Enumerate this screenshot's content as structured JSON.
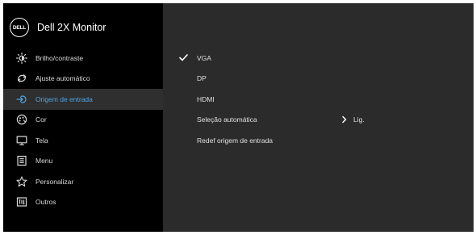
{
  "header": {
    "logo_text": "DELL",
    "title": "Dell 2X Monitor"
  },
  "menu": {
    "items": [
      {
        "label": "Brilho/contraste",
        "icon": "brightness-icon"
      },
      {
        "label": "Ajuste automático",
        "icon": "auto-adjust-icon"
      },
      {
        "label": "Origem de entrada",
        "icon": "input-source-icon"
      },
      {
        "label": "Cor",
        "icon": "color-icon"
      },
      {
        "label": "Tela",
        "icon": "display-icon"
      },
      {
        "label": "Menu",
        "icon": "menu-icon"
      },
      {
        "label": "Personalizar",
        "icon": "star-icon"
      },
      {
        "label": "Outros",
        "icon": "others-icon"
      }
    ],
    "selected": "Origem de entrada"
  },
  "options": {
    "items": [
      {
        "label": "VGA",
        "checked": true
      },
      {
        "label": "DP"
      },
      {
        "label": "HDMI"
      },
      {
        "label": "Seleção automática",
        "value": "Lig."
      },
      {
        "label": "Redef origem de entrada"
      }
    ]
  },
  "colors": {
    "accent": "#4fa3e6",
    "left_bg": "#000000",
    "right_bg": "#2b2b2b",
    "active_bg": "#2f2f2f"
  }
}
